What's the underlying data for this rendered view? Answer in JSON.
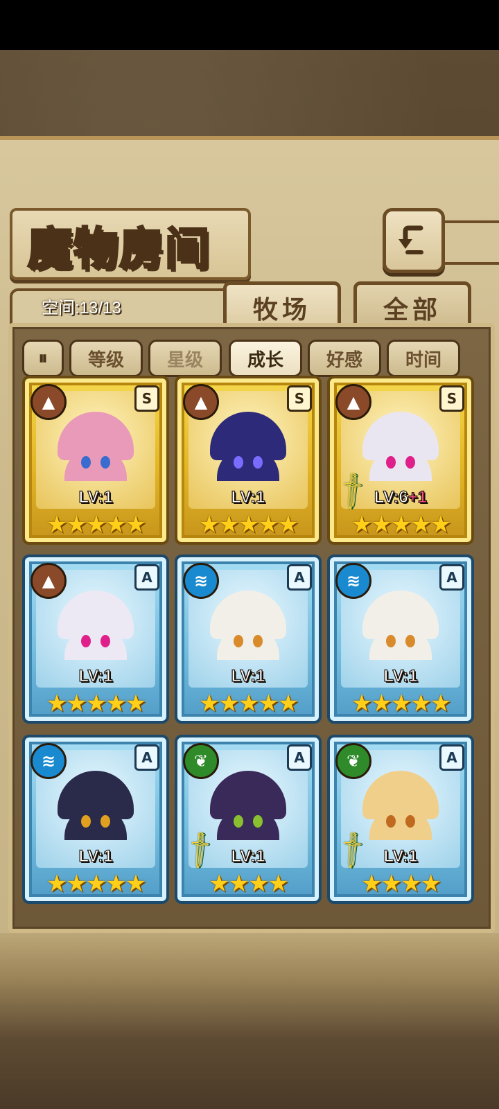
{
  "header": {
    "title": "魔物房间",
    "back_icon": "return-arrow-icon"
  },
  "capacity": {
    "label": "空间:13/13"
  },
  "tabs": [
    {
      "label": "牧场",
      "active": true
    },
    {
      "label": "全部",
      "active": false
    }
  ],
  "sort": {
    "toggle_icon": "order-toggle-icon",
    "buttons": [
      {
        "label": "等级",
        "state": "normal"
      },
      {
        "label": "星级",
        "state": "dim"
      },
      {
        "label": "成长",
        "state": "active"
      },
      {
        "label": "好感",
        "state": "normal"
      },
      {
        "label": "时间",
        "state": "normal"
      }
    ]
  },
  "monsters": [
    {
      "frame": "gold",
      "element": "earth",
      "rank": "S",
      "level": "LV:1",
      "bonus": "",
      "stars": 5,
      "weapon": false,
      "hair": "#e89ab8",
      "eyes": "#3a6cd0"
    },
    {
      "frame": "gold",
      "element": "earth",
      "rank": "S",
      "level": "LV:1",
      "bonus": "",
      "stars": 5,
      "weapon": false,
      "hair": "#2e2a7a",
      "eyes": "#7a6cff"
    },
    {
      "frame": "gold",
      "element": "earth",
      "rank": "S",
      "level": "LV:6",
      "bonus": "+1",
      "stars": 5,
      "weapon": true,
      "hair": "#e9e6f2",
      "eyes": "#e0208a"
    },
    {
      "frame": "blue",
      "element": "earth",
      "rank": "A",
      "level": "LV:1",
      "bonus": "",
      "stars": 5,
      "weapon": false,
      "hair": "#ece9f4",
      "eyes": "#e0208a"
    },
    {
      "frame": "blue",
      "element": "water",
      "rank": "A",
      "level": "LV:1",
      "bonus": "",
      "stars": 5,
      "weapon": false,
      "hair": "#f2efe8",
      "eyes": "#d98a2a"
    },
    {
      "frame": "blue",
      "element": "water",
      "rank": "A",
      "level": "LV:1",
      "bonus": "",
      "stars": 5,
      "weapon": false,
      "hair": "#f2efe8",
      "eyes": "#d98a2a"
    },
    {
      "frame": "blue",
      "element": "water",
      "rank": "A",
      "level": "LV:1",
      "bonus": "",
      "stars": 5,
      "weapon": false,
      "hair": "#2a2a4a",
      "eyes": "#e0a020"
    },
    {
      "frame": "blue",
      "element": "wood",
      "rank": "A",
      "level": "LV:1",
      "bonus": "",
      "stars": 4,
      "weapon": true,
      "hair": "#3a2a5a",
      "eyes": "#8ac030"
    },
    {
      "frame": "blue",
      "element": "wood",
      "rank": "A",
      "level": "LV:1",
      "bonus": "",
      "stars": 4,
      "weapon": true,
      "hair": "#f0cf8a",
      "eyes": "#c06a20"
    }
  ],
  "colors": {
    "earth": "#8a4a2a",
    "water": "#1a8ad0",
    "wood": "#2f8a2a"
  }
}
